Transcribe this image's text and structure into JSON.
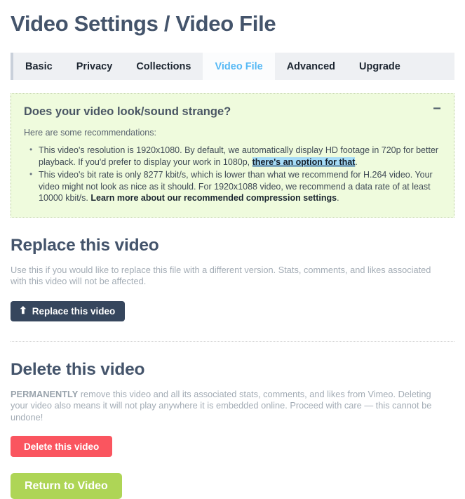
{
  "page_title": "Video Settings / Video File",
  "tabs": [
    {
      "label": "Basic",
      "active": false
    },
    {
      "label": "Privacy",
      "active": false
    },
    {
      "label": "Collections",
      "active": false
    },
    {
      "label": "Video File",
      "active": true
    },
    {
      "label": "Advanced",
      "active": false
    },
    {
      "label": "Upgrade",
      "active": false
    }
  ],
  "notice": {
    "title": "Does your video look/sound strange?",
    "collapse_icon": "−",
    "subtitle": "Here are some recommendations:",
    "bullets": [
      {
        "text_before": "This video's resolution is 1920x1080. By default, we automatically display HD footage in 720p for better playback. If you'd prefer to display your work in 1080p, ",
        "link": "there's an option for that",
        "text_after": "."
      },
      {
        "text_before": "This video's bit rate is only 8277 kbit/s, which is lower than what we recommend for H.264 video. Your video might not look as nice as it should. For 1920x1088 video, we recommend a data rate of at least 10000 kbit/s. ",
        "link": "Learn more about our recommended compression settings",
        "text_after": "."
      }
    ]
  },
  "replace_section": {
    "title": "Replace this video",
    "description": "Use this if you would like to replace this file with a different version. Stats, comments, and likes associated with this video will not be affected.",
    "button_label": "Replace this video",
    "button_icon": "⬆"
  },
  "delete_section": {
    "title": "Delete this video",
    "description_strong": "PERMANENTLY",
    "description_rest": " remove this video and all its associated stats, comments, and likes from Vimeo. Deleting your video also means it will not play anywhere it is embedded online. Proceed with care — this cannot be undone!",
    "button_label": "Delete this video"
  },
  "return_button": {
    "label": "Return to Video"
  },
  "colors": {
    "heading": "#44546b",
    "tab_active_text": "#56b9f5",
    "tab_bar_bg": "#eef0f3",
    "notice_bg": "#effbdd",
    "notice_border": "#b9cf99",
    "link_highlight": "#a6dcf7",
    "replace_button": "#36465d",
    "delete_button": "#fa555f",
    "return_button": "#aed556"
  }
}
